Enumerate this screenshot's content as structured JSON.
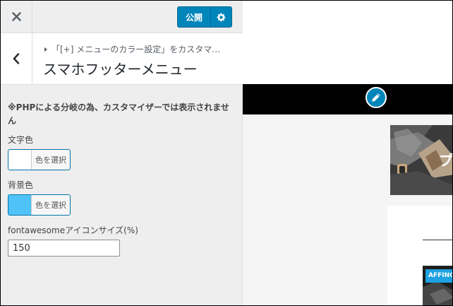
{
  "topbar": {
    "publish_label": "公開"
  },
  "section": {
    "breadcrumb": "「[+] メニューのカラー設定」をカスタマ…",
    "title": "スマホフッターメニュー"
  },
  "controls": {
    "notice": "※PHPによる分岐の為、カスタマイザーでは表示されません",
    "text_color": {
      "label": "文字色",
      "button_text": "色を選択",
      "swatch_color": "#ffffff"
    },
    "bg_color": {
      "label": "背景色",
      "button_text": "色を選択",
      "swatch_color": "#4fc3f7"
    },
    "icon_size": {
      "label": "fontawesomeアイコンサイズ(%)",
      "value": "150"
    }
  },
  "preview": {
    "hero_char": "プ",
    "badge": "AFFING"
  },
  "colors": {
    "accent": "#0085ba",
    "sidebar_bg": "#eeeeee"
  }
}
